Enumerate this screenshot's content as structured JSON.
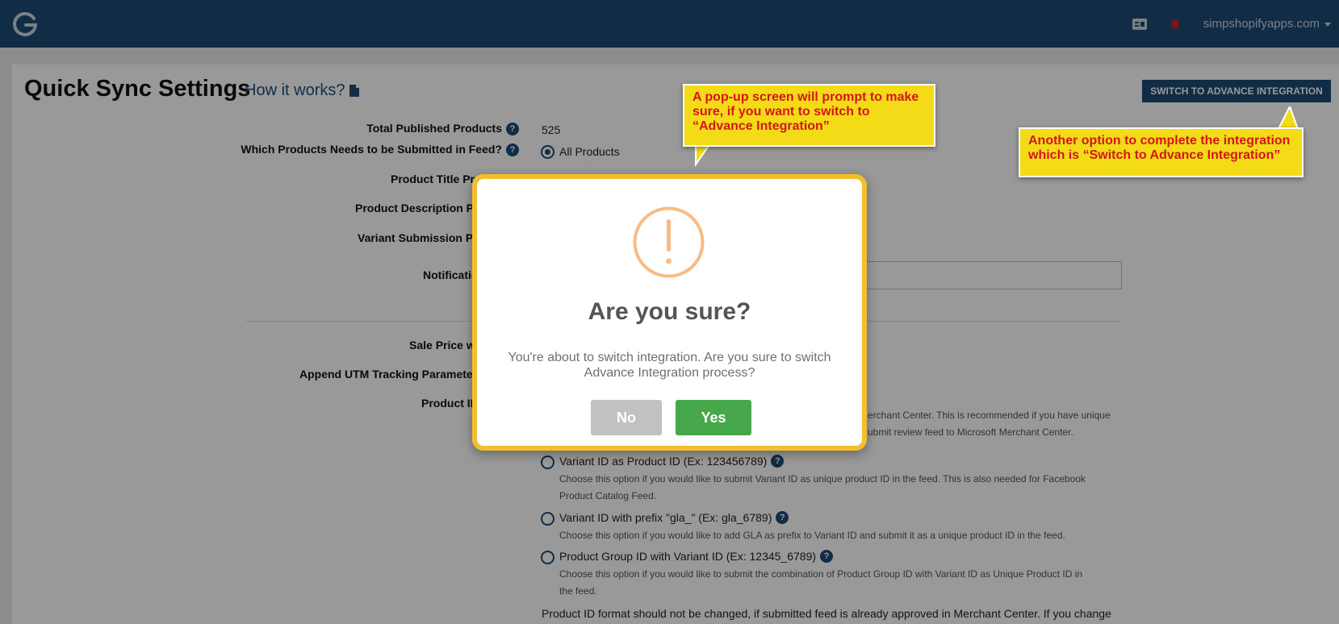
{
  "topbar": {
    "logo_letter": "G",
    "store_name": "simpshopifyapps.com",
    "icons": [
      "id-card-icon",
      "bell-icon"
    ],
    "accent_color": "#1d4a73"
  },
  "page": {
    "title": "Quick Sync Settings",
    "how_it_works": "How it works?",
    "switch_button": "SWITCH TO ADVANCE INTEGRATION"
  },
  "form": {
    "total_products_label": "Total Published Products",
    "total_products_value": "525",
    "which_products_label": "Which Products Needs to be Submitted in Feed?",
    "which_products_value": "All Products",
    "title_pref_label": "Product Title Pre",
    "desc_pref_label": "Product Description Pre",
    "variant_pref_label": "Variant Submission Pre",
    "notification_label": "Notificatio",
    "sale_price_label": "Sale Price w",
    "utm_label": "Append UTM Tracking Parameters",
    "product_id_label": "Product ID",
    "help_glyph": "?",
    "hidden_option_desc_1": "erchant Center. This is recommended if you have unique",
    "hidden_option_desc_2": "ubmit review feed to Microsoft Merchant Center.",
    "options": [
      {
        "label": "Variant ID as Product ID (Ex: 123456789)",
        "desc": "Choose this option if you would like to submit Variant ID as unique product ID in the feed. This is also needed for Facebook Product Catalog Feed."
      },
      {
        "label": "Variant ID with prefix \"gla_\" (Ex: gla_6789)",
        "desc": "Choose this option if you would like to add GLA as prefix to Variant ID and submit it as a unique product ID in the feed."
      },
      {
        "label": "Product Group ID with Variant ID (Ex: 12345_6789)",
        "desc": "Choose this option if you would like to submit the combination of Product Group ID with Variant ID as Unique Product ID in the feed."
      }
    ],
    "warning": "Product ID format should not be changed, if submitted feed is already approved in Merchant Center. If you change"
  },
  "modal": {
    "icon": "exclamation-icon",
    "icon_glyph": "!",
    "title": "Are you sure?",
    "text": "You're about to switch integration. Are you sure to switch Advance Integration process?",
    "no_label": "No",
    "yes_label": "Yes",
    "border_color": "#f2c02e",
    "yes_color": "#46a84b"
  },
  "annotations": {
    "callout_1": "A pop-up screen will prompt to make sure, if you want to switch to “Advance Integration”",
    "callout_2": "Another option to complete the integration which is “Switch to Advance Integration”",
    "color": "#f3dc17",
    "text_color": "#d4161b"
  }
}
